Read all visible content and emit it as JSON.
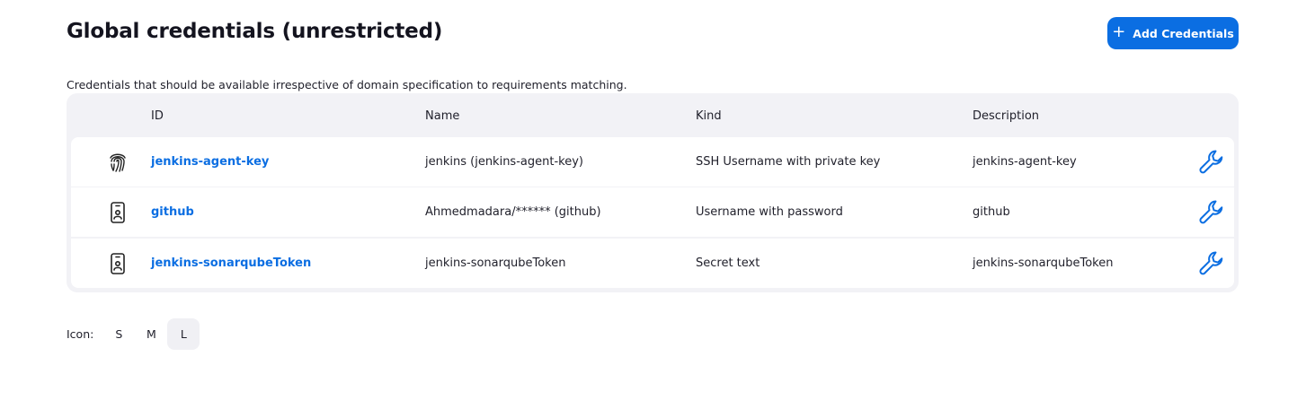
{
  "header": {
    "title": "Global credentials (unrestricted)",
    "add_button_label": "Add Credentials",
    "add_button_icon": "plus-icon",
    "description": "Credentials that should be available irrespective of domain specification to requirements matching."
  },
  "table": {
    "columns": [
      "ID",
      "Name",
      "Kind",
      "Description"
    ],
    "rows": [
      {
        "icon": "fingerprint-icon",
        "id": "jenkins-agent-key",
        "name": "jenkins (jenkins-agent-key)",
        "kind": "SSH Username with private key",
        "description": "jenkins-agent-key",
        "action_icon": "wrench-icon"
      },
      {
        "icon": "id-badge-icon",
        "id": "github",
        "name": "Ahmedmadara/****** (github)",
        "kind": "Username with password",
        "description": "github",
        "action_icon": "wrench-icon"
      },
      {
        "icon": "id-badge-icon",
        "id": "jenkins-sonarqubeToken",
        "name": "jenkins-sonarqubeToken",
        "kind": "Secret text",
        "description": "jenkins-sonarqubeToken",
        "action_icon": "wrench-icon"
      }
    ]
  },
  "icon_size": {
    "label": "Icon:",
    "options": [
      "S",
      "M",
      "L"
    ],
    "selected": "L"
  },
  "colors": {
    "accent": "#0b6ee2",
    "table_background": "#f2f2f6",
    "selected_option_background": "#f0f0f4"
  }
}
